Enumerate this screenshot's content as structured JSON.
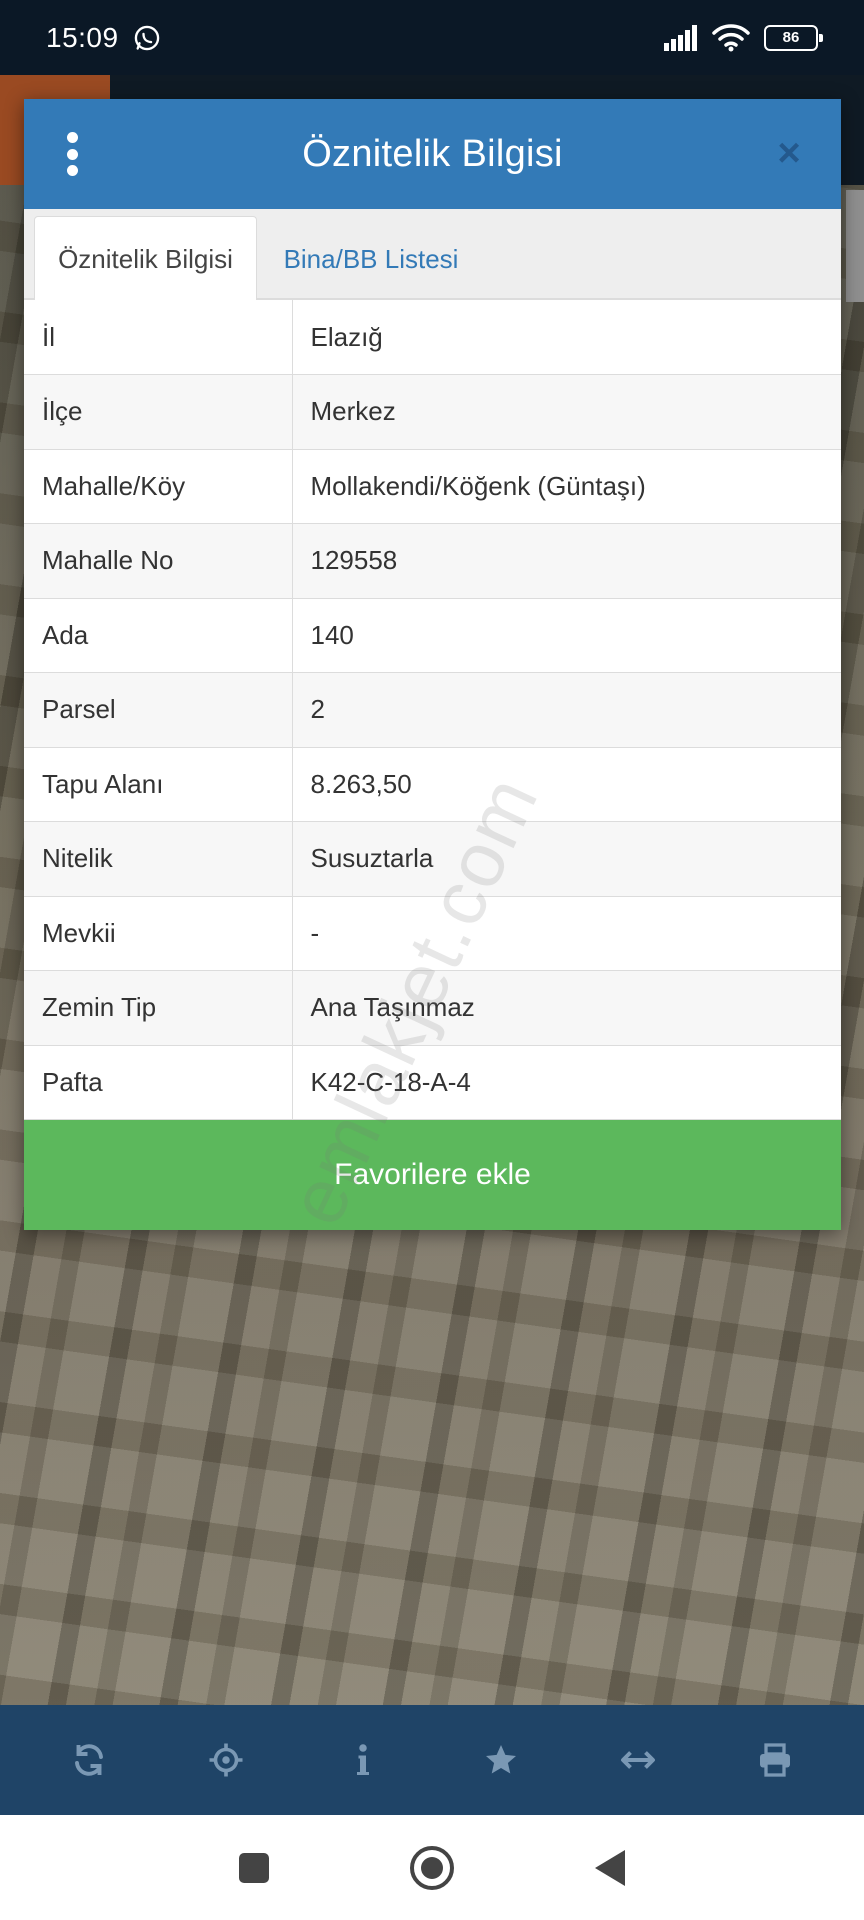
{
  "status_bar": {
    "time": "15:09",
    "battery": "86",
    "icons": [
      "whatsapp-icon",
      "signal-icon",
      "wifi-icon",
      "battery-icon"
    ]
  },
  "dialog": {
    "title": "Öznitelik Bilgisi",
    "close_label": "×",
    "tabs": [
      {
        "label": "Öznitelik Bilgisi",
        "active": true
      },
      {
        "label": "Bina/BB Listesi",
        "active": false
      }
    ],
    "rows": [
      {
        "key": "İl",
        "value": "Elazığ"
      },
      {
        "key": "İlçe",
        "value": "Merkez"
      },
      {
        "key": "Mahalle/Köy",
        "value": "Mollakendi/Köğenk (Güntaşı)"
      },
      {
        "key": "Mahalle No",
        "value": "129558"
      },
      {
        "key": "Ada",
        "value": "140"
      },
      {
        "key": "Parsel",
        "value": "2"
      },
      {
        "key": "Tapu Alanı",
        "value": "8.263,50"
      },
      {
        "key": "Nitelik",
        "value": "Susuztarla"
      },
      {
        "key": "Mevkii",
        "value": "-"
      },
      {
        "key": "Zemin Tip",
        "value": "Ana Taşınmaz"
      },
      {
        "key": "Pafta",
        "value": "K42-C-18-A-4"
      }
    ],
    "favorite_button": "Favorilere ekle"
  },
  "watermark": "emlakjet.com",
  "toolbar": {
    "items": [
      "refresh-icon",
      "locate-icon",
      "info-icon",
      "star-icon",
      "measure-icon",
      "print-icon"
    ]
  },
  "colors": {
    "header": "#337ab7",
    "favorite": "#5cb85c",
    "toolbar": "#1f4467",
    "status_bar": "#0b1826"
  }
}
